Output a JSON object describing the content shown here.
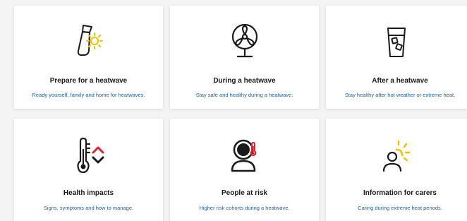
{
  "cards": [
    {
      "title": "Prepare for a heatwave",
      "description": "Ready yourself, family and home for heatwaves.",
      "icon": "sunscreen-icon"
    },
    {
      "title": "During a heatwave",
      "description": "Stay safe and healthy during a heatwave.",
      "icon": "fan-icon"
    },
    {
      "title": "After a heatwave",
      "description": "Stay healthy after hot weather or extreme heat.",
      "icon": "iced-drink-icon"
    },
    {
      "title": "Health impacts",
      "description": "Signs, symptoms and how to manage.",
      "icon": "thermometer-icon"
    },
    {
      "title": "People at risk",
      "description": "Higher risk cohorts during a heatwave.",
      "icon": "person-temperature-icon"
    },
    {
      "title": "Information for carers",
      "description": "Caring during extreme heat periods.",
      "icon": "carer-sun-icon"
    }
  ],
  "colors": {
    "title": "#1a1a1a",
    "link": "#1f5fa0",
    "sun": "#f2c200",
    "alert": "#d9232d"
  }
}
